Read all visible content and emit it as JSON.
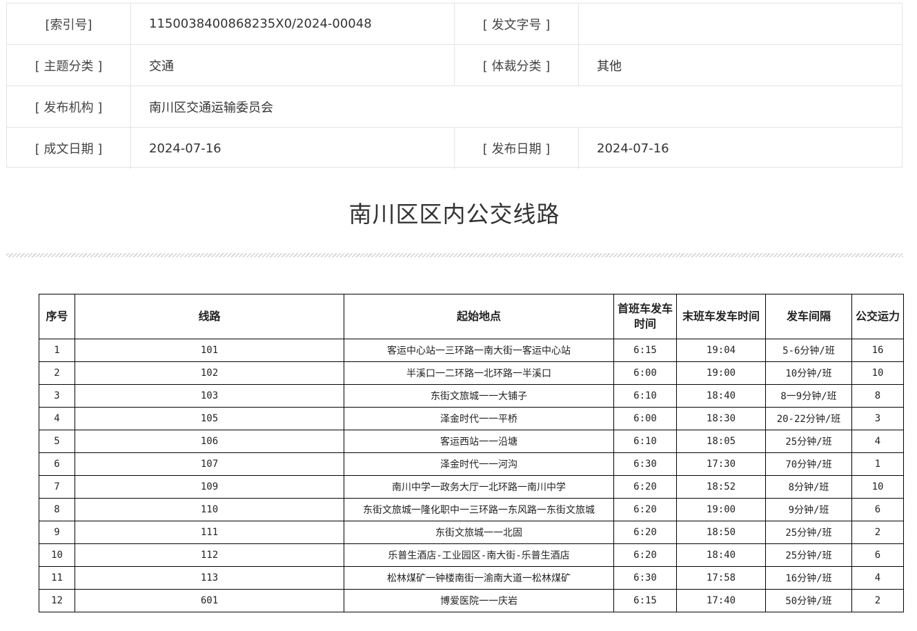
{
  "meta": {
    "rows": [
      {
        "label1": "[索引号]",
        "value1": "115003840086823​5X0/2024-00048",
        "label2": "[ 发文字号 ]",
        "value2": ""
      },
      {
        "label1": "[ 主题分类 ]",
        "value1": "交通",
        "label2": "[ 体裁分类 ]",
        "value2": "其他"
      },
      {
        "label1": "[ 发布机构 ]",
        "value1": "南川区交通运输委员会"
      },
      {
        "label1": "[ 成文日期 ]",
        "value1": "2024-07-16",
        "label2": "[ 发布日期 ]",
        "value2": "2024-07-16"
      }
    ]
  },
  "title": "南川区区内公交线路",
  "table": {
    "headers": [
      "序号",
      "线路",
      "起始地点",
      "首班车发车时间",
      "末班车发车时间",
      "发车间隔",
      "公交运力"
    ],
    "rows": [
      [
        "1",
        "101",
        "客运中心站一三环路一南大街一客运中心站",
        "6:15",
        "19:04",
        "5-6分钟/班",
        "16"
      ],
      [
        "2",
        "102",
        "半溪口一二环路一北环路一半溪口",
        "6:00",
        "19:00",
        "10分钟/班",
        "10"
      ],
      [
        "3",
        "103",
        "东街文旅城一一大铺子",
        "6:10",
        "18:40",
        "8一9分钟/班",
        "8"
      ],
      [
        "4",
        "105",
        "泽金时代一一平桥",
        "6:00",
        "18:30",
        "20-22分钟/班",
        "3"
      ],
      [
        "5",
        "106",
        "客运西站一一沿塘",
        "6:10",
        "18:05",
        "25分钟/班",
        "4"
      ],
      [
        "6",
        "107",
        "泽金时代一一河沟",
        "6:30",
        "17:30",
        "70分钟/班",
        "1"
      ],
      [
        "7",
        "109",
        "南川中学一政务大厅一北环路一南川中学",
        "6:20",
        "18:52",
        "8分钟/班",
        "10"
      ],
      [
        "8",
        "110",
        "东街文旅城一隆化职中一三环路一东风路一东街文旅城",
        "6:20",
        "19:00",
        "9分钟/班",
        "6"
      ],
      [
        "9",
        "111",
        "东街文旅城一一北固",
        "6:20",
        "18:50",
        "25分钟/班",
        "2"
      ],
      [
        "10",
        "112",
        "乐普生酒店-工业园区-南大街-乐普生酒店",
        "6:20",
        "18:40",
        "25分钟/班",
        "6"
      ],
      [
        "11",
        "113",
        "松林煤矿一钟楼南街一渝南大道一松林煤矿",
        "6:30",
        "17:58",
        "16分钟/班",
        "4"
      ],
      [
        "12",
        "601",
        "博爱医院一一庆岩",
        "6:15",
        "17:40",
        "50分钟/班",
        "2"
      ]
    ]
  }
}
